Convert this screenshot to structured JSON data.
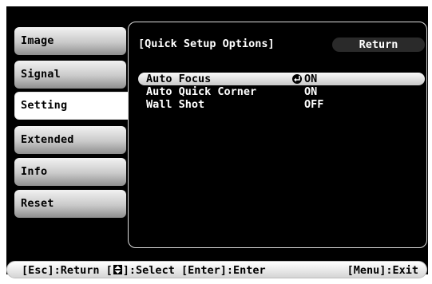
{
  "menu": {
    "tabs": [
      {
        "label": "Image"
      },
      {
        "label": "Signal"
      },
      {
        "label": "Setting"
      },
      {
        "label": "Extended"
      },
      {
        "label": "Info"
      },
      {
        "label": "Reset"
      }
    ],
    "selected_tab": "Setting"
  },
  "panel": {
    "title": "[Quick Setup Options]",
    "return_label": "Return",
    "options": [
      {
        "label": "Auto Focus",
        "value": "ON",
        "selected": true,
        "icon": "enter-arrow-icon"
      },
      {
        "label": "Auto Quick Corner",
        "value": "ON",
        "selected": false
      },
      {
        "label": "Wall Shot",
        "value": "OFF",
        "selected": false
      }
    ]
  },
  "footer": {
    "esc_text": "[Esc]:Return [",
    "select_text": "]:Select [Enter]:Enter",
    "menu_text": "[Menu]:Exit",
    "icon": "up-down-arrows-icon"
  },
  "colors": {
    "background": "#000000",
    "highlight": "#e0e0e0",
    "text": "#ffffff"
  }
}
